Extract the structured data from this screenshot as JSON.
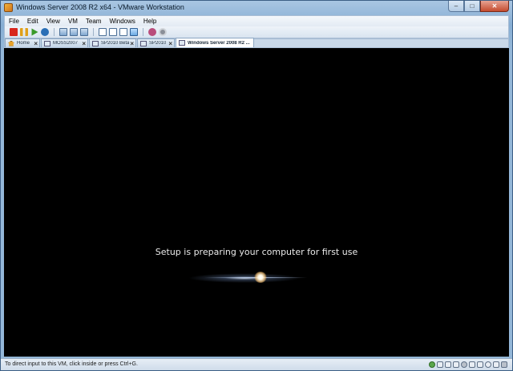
{
  "window": {
    "title": "Windows Server 2008 R2 x64 - VMware Workstation",
    "caption_minimize": "–",
    "caption_maximize": "□",
    "caption_close": "✕"
  },
  "menubar": {
    "items": [
      "File",
      "Edit",
      "View",
      "VM",
      "Team",
      "Windows",
      "Help"
    ]
  },
  "toolbar": {
    "icons": [
      "power-off-icon",
      "suspend-icon",
      "power-on-icon",
      "reset-icon",
      "snapshot-icon",
      "revert-snapshot-icon",
      "snapshot-manager-icon",
      "quick-switch-icon",
      "full-screen-icon",
      "unity-icon",
      "console-view-icon",
      "usb-device-icon",
      "removable-disk-icon"
    ]
  },
  "tabs": [
    {
      "label": "Home",
      "close": "×",
      "active": false
    },
    {
      "label": "MOSS2007",
      "close": "×",
      "active": false
    },
    {
      "label": "SP2010 Beta",
      "close": "×",
      "active": false
    },
    {
      "label": "SP2010",
      "close": "×",
      "active": false
    },
    {
      "label": "Windows Server 2008 R2 ...",
      "close": "×",
      "active": true
    }
  ],
  "vm_screen": {
    "message": "Setup is preparing your computer for first use"
  },
  "statusbar": {
    "text": "To direct input to this VM, click inside or press Ctrl+G."
  }
}
